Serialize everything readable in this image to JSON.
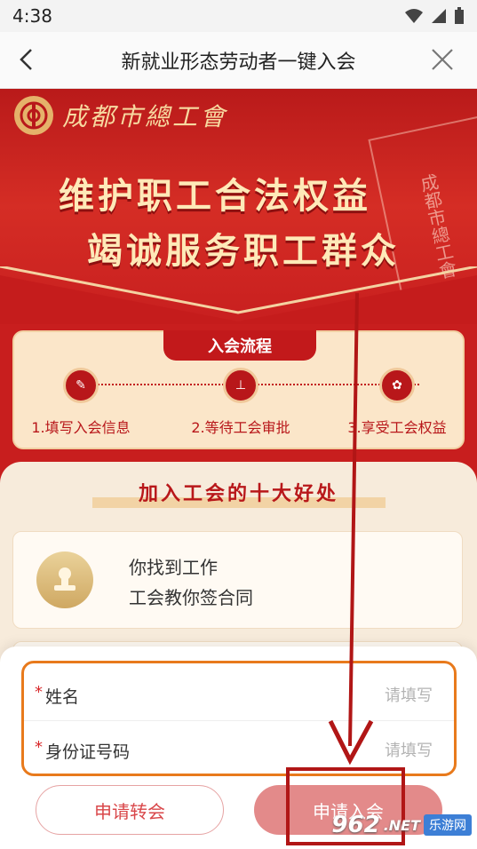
{
  "status_bar": {
    "time": "4:38"
  },
  "nav": {
    "title": "新就业形态劳动者一键入会"
  },
  "hero": {
    "org_name": "成都市總工會",
    "slogan_line1": "维护职工合法权益",
    "slogan_line2": "竭诚服务职工群众",
    "booklet_text": "成都市總工會"
  },
  "process": {
    "tag": "入会流程",
    "steps": [
      {
        "label": "1.填写入会信息",
        "icon": "edit-icon"
      },
      {
        "label": "2.等待工会审批",
        "icon": "stamp-icon"
      },
      {
        "label": "3.享受工会权益",
        "icon": "badge-icon"
      }
    ]
  },
  "benefits": {
    "heading": "加入工会的十大好处",
    "items": [
      {
        "line1": "你找到工作",
        "line2": "工会教你签合同",
        "icon": "stamp-icon"
      }
    ]
  },
  "form": {
    "fields": [
      {
        "label": "姓名",
        "placeholder": "请填写",
        "value": ""
      },
      {
        "label": "身份证号码",
        "placeholder": "请填写",
        "value": ""
      }
    ],
    "required_mark": "*"
  },
  "actions": {
    "transfer_label": "申请转会",
    "join_label": "申请入会"
  },
  "watermark": {
    "number": "962",
    "brand": "乐游网",
    "suffix": ".NET"
  },
  "colors": {
    "primary_red": "#c81e1e",
    "gold": "#ffe9b8",
    "highlight_orange": "#e87a1c"
  }
}
